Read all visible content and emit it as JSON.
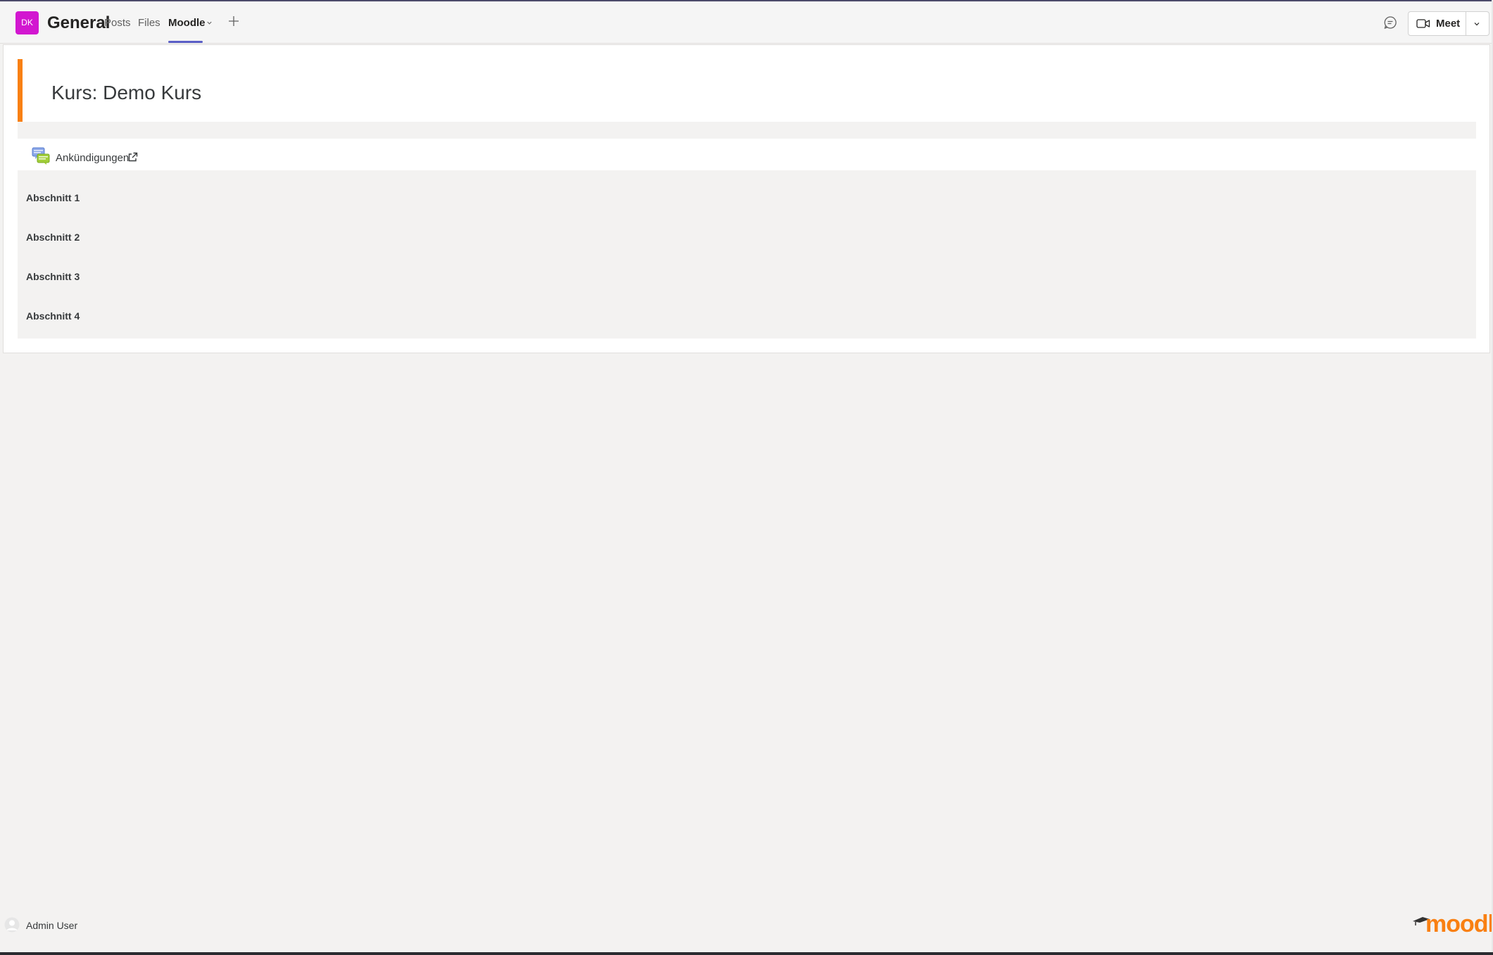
{
  "header": {
    "team_initials": "DK",
    "channel_name": "General",
    "tabs": [
      {
        "label": "Posts",
        "active": false
      },
      {
        "label": "Files",
        "active": false
      },
      {
        "label": "Moodle",
        "active": true
      }
    ],
    "meet_label": "Meet",
    "accent_color": "#5b5fc7",
    "team_color": "#d217d0"
  },
  "course": {
    "title": "Kurs: Demo Kurs",
    "accent_color": "#f98012",
    "forum_link": "Ankündigungen",
    "sections": [
      "Abschnitt 1",
      "Abschnitt 2",
      "Abschnitt 3",
      "Abschnitt 4"
    ]
  },
  "footer": {
    "user_name": "Admin User",
    "brand": "moodle",
    "brand_color": "#f98012"
  },
  "icons": [
    "chevron-down-icon",
    "plus-icon",
    "chat-icon",
    "video-camera-icon",
    "forum-icon",
    "external-link-icon",
    "user-avatar-icon",
    "moodle-logo"
  ]
}
